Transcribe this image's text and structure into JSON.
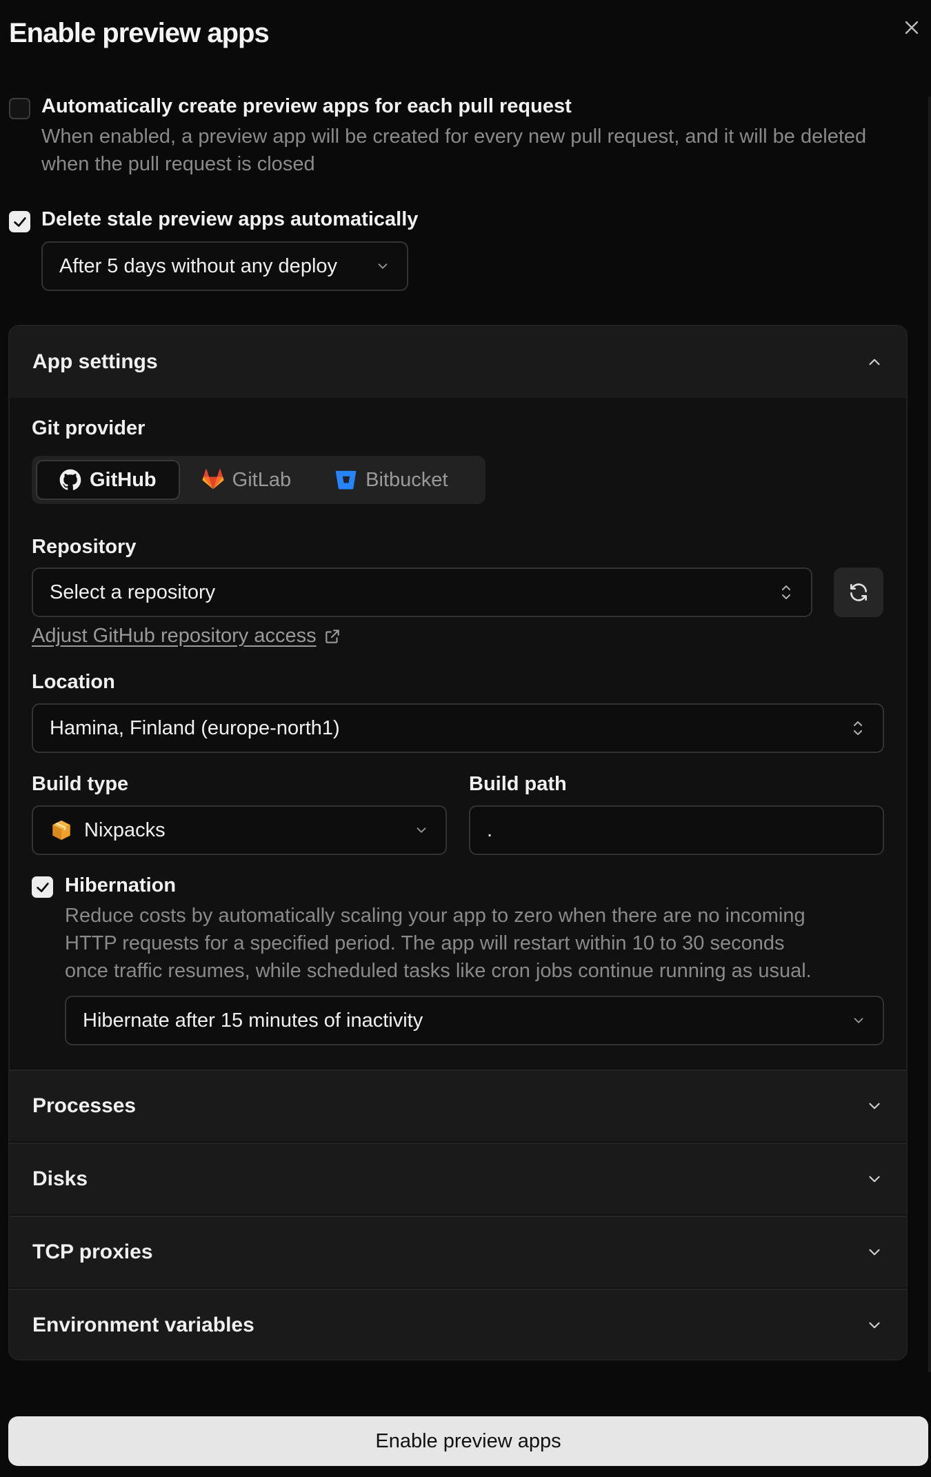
{
  "dialog": {
    "title": "Enable preview apps",
    "submit_label": "Enable preview apps"
  },
  "auto_create": {
    "checked": false,
    "label": "Automatically create preview apps for each pull request",
    "description_line1": "When enabled, a preview app will be created for every new pull request, and it will be deleted",
    "description_line2": "when the pull request is closed"
  },
  "delete_stale": {
    "checked": true,
    "label": "Delete stale preview apps automatically",
    "selected": "After 5 days without any deploy"
  },
  "app_settings": {
    "title": "App settings",
    "git_provider": {
      "label": "Git provider",
      "options": [
        "GitHub",
        "GitLab",
        "Bitbucket"
      ],
      "selected": "GitHub"
    },
    "repository": {
      "label": "Repository",
      "placeholder": "Select a repository",
      "access_link": "Adjust GitHub repository access"
    },
    "location": {
      "label": "Location",
      "selected": "Hamina, Finland (europe-north1)"
    },
    "build_type": {
      "label": "Build type",
      "selected": "Nixpacks"
    },
    "build_path": {
      "label": "Build path",
      "value": "."
    },
    "hibernation": {
      "checked": true,
      "label": "Hibernation",
      "description_line1": "Reduce costs by automatically scaling your app to zero when there are no incoming",
      "description_line2": "HTTP requests for a specified period. The app will restart within 10 to 30 seconds",
      "description_line3": "once traffic resumes, while scheduled tasks like cron jobs continue running as usual.",
      "selected": "Hibernate after 15 minutes of inactivity"
    }
  },
  "sections": [
    "Processes",
    "Disks",
    "TCP proxies",
    "Environment variables"
  ]
}
